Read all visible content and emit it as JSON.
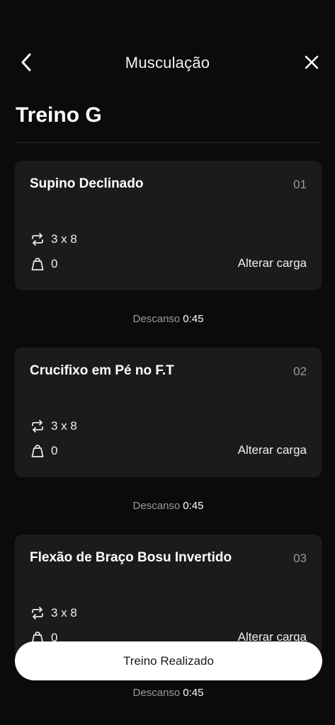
{
  "header": {
    "title": "Musculação"
  },
  "page": {
    "title": "Treino G"
  },
  "exercises": [
    {
      "name": "Supino Declinado",
      "index": "01",
      "sets": "3 x 8",
      "load": "0",
      "action_label": "Alterar carga",
      "rest_label": "Descanso",
      "rest_value": "0:45"
    },
    {
      "name": "Crucifixo em Pé no F.T",
      "index": "02",
      "sets": "3 x 8",
      "load": "0",
      "action_label": "Alterar carga",
      "rest_label": "Descanso",
      "rest_value": "0:45"
    },
    {
      "name": "Flexão de Braço Bosu Invertido",
      "index": "03",
      "sets": "3 x 8",
      "load": "0",
      "action_label": "Alterar carga",
      "rest_label": "Descanso",
      "rest_value": "0:45"
    }
  ],
  "footer": {
    "finish_label": "Treino Realizado"
  },
  "icons": {
    "back": "chevron-left-icon",
    "close": "close-icon",
    "sets": "repeat-icon",
    "load": "weight-icon"
  },
  "colors": {
    "background": "#0b0b0b",
    "card": "#1b1b1b",
    "muted_text": "#9a9a9a",
    "button_bg": "#ffffff"
  }
}
